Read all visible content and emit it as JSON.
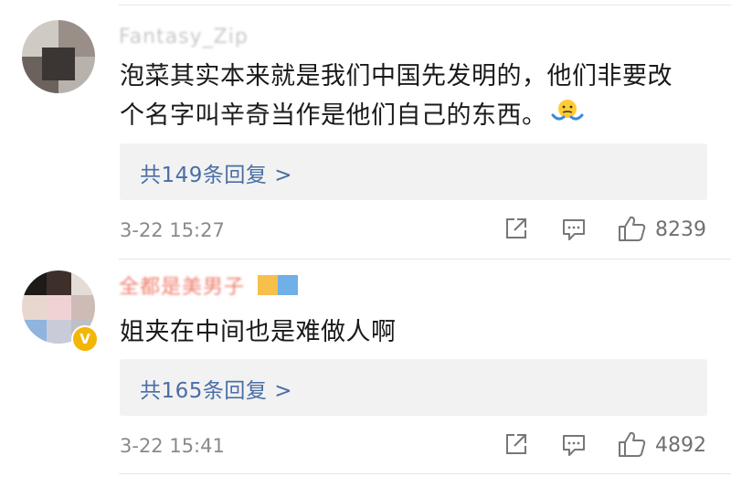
{
  "comments": [
    {
      "username": "Fantasy_Zip",
      "text_line1": "泡菜其实本来就是我们中国先发明的，他们非要改",
      "text_line2": "个名字叫辛奇当作是他们自己的东西。",
      "emoji": "shrug-emoji",
      "replies_label": "共149条回复 >",
      "time": "3-22 15:27",
      "likes": "8239"
    },
    {
      "username": "全都是美男子",
      "text_line1": "姐夹在中间也是难做人啊",
      "replies_label": "共165条回复 >",
      "time": "3-22 15:41",
      "likes": "4892",
      "badge": "V"
    }
  ],
  "icons": {
    "share": "share-icon",
    "comment": "comment-icon",
    "like": "thumbs-up-icon"
  },
  "colors": {
    "link": "#4a6ea5",
    "meta": "#8a8a8a",
    "reply_bg": "#f2f2f2",
    "badge": "#f2b705"
  }
}
